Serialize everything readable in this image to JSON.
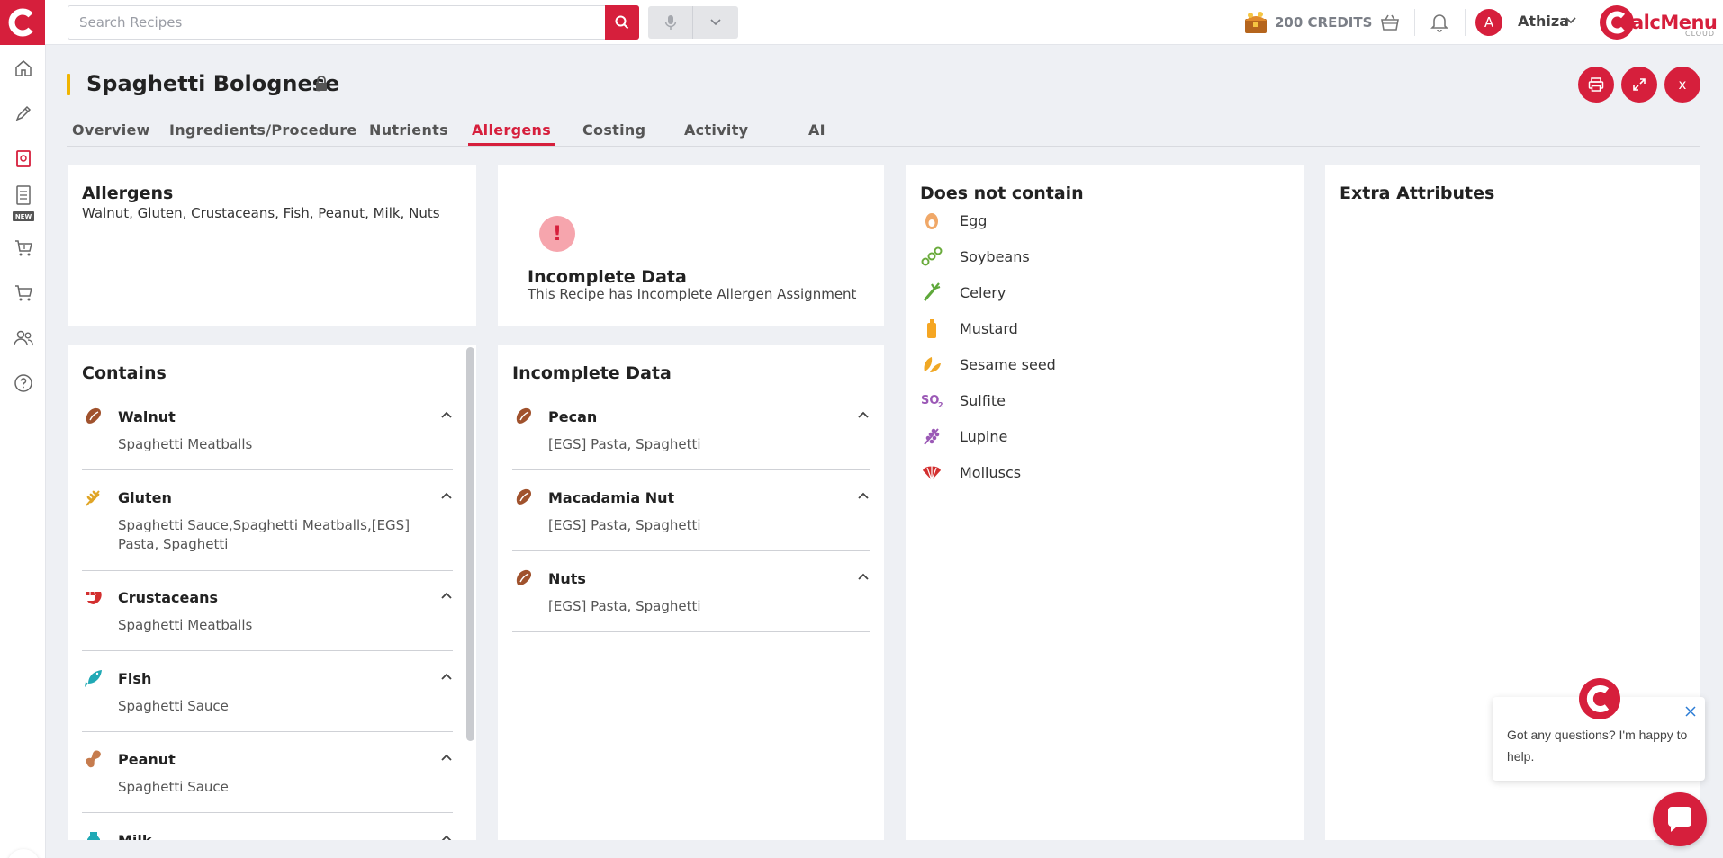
{
  "topbar": {
    "search_placeholder": "Search Recipes",
    "credits": "200 CREDITS",
    "user_initial": "A",
    "username": "Athiza",
    "brand_text": "alcMenu",
    "brand_sub": "CLOUD"
  },
  "sidebar": {
    "new_badge": "NEW",
    "items": [
      "home-icon",
      "pen-icon",
      "recipe-icon",
      "menu-icon",
      "cart-icon",
      "cart-icon",
      "users-icon",
      "help-icon"
    ]
  },
  "header": {
    "title": "Spaghetti Bolognese",
    "close_label": "x"
  },
  "tabs": [
    {
      "label": "Overview"
    },
    {
      "label": "Ingredients/Procedure"
    },
    {
      "label": "Nutrients"
    },
    {
      "label": "Allergens"
    },
    {
      "label": "Costing"
    },
    {
      "label": "Activity"
    },
    {
      "label": "AI"
    }
  ],
  "active_tab": "Allergens",
  "allergens_summary": {
    "title": "Allergens",
    "list": "Walnut, Gluten, Crustaceans, Fish, Peanut, Milk, Nuts"
  },
  "incomplete_notice": {
    "icon": "!",
    "title": "Incomplete Data",
    "subtitle": "This Recipe has Incomplete Allergen Assignment"
  },
  "contains": {
    "title": "Contains",
    "items": [
      {
        "name": "Walnut",
        "sources": "Spaghetti Meatballs",
        "icon": "nut-icon"
      },
      {
        "name": "Gluten",
        "sources": "Spaghetti Sauce,Spaghetti Meatballs,[EGS] Pasta, Spaghetti",
        "icon": "wheat-icon"
      },
      {
        "name": "Crustaceans",
        "sources": "Spaghetti Meatballs",
        "icon": "shrimp-icon"
      },
      {
        "name": "Fish",
        "sources": "Spaghetti Sauce",
        "icon": "fish-icon"
      },
      {
        "name": "Peanut",
        "sources": "Spaghetti Sauce",
        "icon": "peanut-icon"
      },
      {
        "name": "Milk",
        "sources": "",
        "icon": "milk-icon"
      }
    ]
  },
  "incomplete_data": {
    "title": "Incomplete Data",
    "items": [
      {
        "name": "Pecan",
        "sources": "[EGS] Pasta, Spaghetti",
        "icon": "nut-icon"
      },
      {
        "name": "Macadamia Nut",
        "sources": "[EGS] Pasta, Spaghetti",
        "icon": "nut-icon"
      },
      {
        "name": "Nuts",
        "sources": "[EGS] Pasta, Spaghetti",
        "icon": "nut-icon"
      }
    ]
  },
  "does_not_contain": {
    "title": "Does not contain",
    "items": [
      {
        "label": "Egg",
        "icon": "egg-icon"
      },
      {
        "label": "Soybeans",
        "icon": "soybean-icon"
      },
      {
        "label": "Celery",
        "icon": "celery-icon"
      },
      {
        "label": "Mustard",
        "icon": "mustard-icon"
      },
      {
        "label": "Sesame seed",
        "icon": "sesame-icon"
      },
      {
        "label": "Sulfite",
        "icon": "sulfite-icon"
      },
      {
        "label": "Lupine",
        "icon": "lupine-icon"
      },
      {
        "label": "Molluscs",
        "icon": "mollusc-icon"
      }
    ]
  },
  "extra_attributes": {
    "title": "Extra Attributes"
  },
  "chat": {
    "message": "Got any questions? I'm happy to help."
  },
  "colors": {
    "brand": "#d61f3c",
    "accent": "#f0b400",
    "background": "#eef0f4"
  }
}
